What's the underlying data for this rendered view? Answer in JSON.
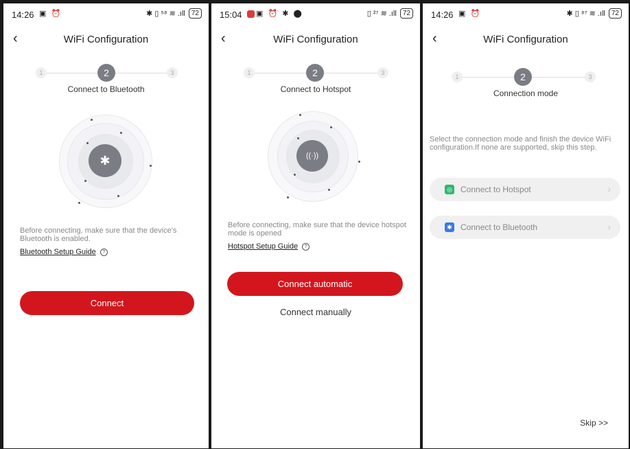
{
  "screens": [
    {
      "status": {
        "time": "14:26",
        "left_icons": "▣ ⏰",
        "right_icons": "✱ ▯ ⁵⁸ ≋ .ıll",
        "battery": "72"
      },
      "header": {
        "title": "WiFi Configuration",
        "back_icon": "‹"
      },
      "stepper": {
        "step1": "1",
        "step2": "2",
        "step3": "3",
        "label": "Connect to Bluetooth"
      },
      "radar": {
        "icon": "bluetooth-icon",
        "glyph": "✱"
      },
      "info": "Before connecting, make sure that the device's Bluetooth is enabled.",
      "guide": {
        "link": "Bluetooth Setup Guide",
        "help": "?"
      },
      "primary_button": "Connect"
    },
    {
      "status": {
        "time": "15:04",
        "left_icons": "▣ ⏰ ✱ ⬤",
        "right_icons": "▯ ²⁷ ≋ .ıll",
        "battery": "72"
      },
      "header": {
        "title": "WiFi Configuration",
        "back_icon": "‹"
      },
      "stepper": {
        "step1": "1",
        "step2": "2",
        "step3": "3",
        "label": "Connect to Hotspot"
      },
      "radar": {
        "icon": "hotspot-icon",
        "glyph": "((·))"
      },
      "info": "Before connecting, make sure that the device hotspot mode is opened",
      "guide": {
        "link": "Hotspot Setup Guide",
        "help": "?"
      },
      "primary_button": "Connect automatic",
      "secondary_button": "Connect manually"
    },
    {
      "status": {
        "time": "14:26",
        "left_icons": "▣ ⏰",
        "right_icons": "✱ ▯ ⁸⁷ ≋ .ıll",
        "battery": "72"
      },
      "header": {
        "title": "WiFi Configuration",
        "back_icon": "‹"
      },
      "stepper": {
        "step1": "1",
        "step2": "2",
        "step3": "3",
        "label": "Connection mode"
      },
      "info": "Select the connection mode and finish the device WiFi configuration.If none are supported, skip this step.",
      "modes": [
        {
          "label": "Connect to Hotspot",
          "icon": "hotspot-icon",
          "glyph": "◎",
          "color": "#2fb86a"
        },
        {
          "label": "Connect to Bluetooth",
          "icon": "bluetooth-icon",
          "glyph": "✱",
          "color": "#3a7be0"
        }
      ],
      "chevron": "›",
      "skip": "Skip >>"
    }
  ],
  "colors": {
    "accent_red": "#d3161e",
    "step_active": "#7a7d84"
  }
}
